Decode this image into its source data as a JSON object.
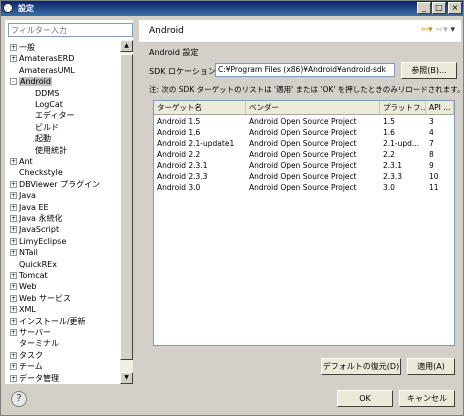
{
  "window": {
    "title": "設定",
    "min_label": "_",
    "max_label": "□",
    "close_label": "×"
  },
  "filter": {
    "placeholder": "フィルター入力"
  },
  "tree": [
    {
      "label": "一般",
      "expander": "+"
    },
    {
      "label": "AmaterasERD",
      "expander": "+"
    },
    {
      "label": "AmaterasUML",
      "expander": ""
    },
    {
      "label": "Android",
      "expander": "-",
      "selected": true
    },
    {
      "label": "DDMS",
      "child": true
    },
    {
      "label": "LogCat",
      "child": true
    },
    {
      "label": "エディター",
      "child": true
    },
    {
      "label": "ビルド",
      "child": true
    },
    {
      "label": "起動",
      "child": true
    },
    {
      "label": "使用統計",
      "child": true
    },
    {
      "label": "Ant",
      "expander": "+"
    },
    {
      "label": "Checkstyle",
      "expander": ""
    },
    {
      "label": "DBViewer プラグイン",
      "expander": "+"
    },
    {
      "label": "Java",
      "expander": "+"
    },
    {
      "label": "Java EE",
      "expander": "+"
    },
    {
      "label": "Java 永続化",
      "expander": "+"
    },
    {
      "label": "JavaScript",
      "expander": "+"
    },
    {
      "label": "LimyEclipse",
      "expander": "+"
    },
    {
      "label": "NTail",
      "expander": "+"
    },
    {
      "label": "QuickREx",
      "expander": ""
    },
    {
      "label": "Tomcat",
      "expander": "+"
    },
    {
      "label": "Web",
      "expander": "+"
    },
    {
      "label": "Web サービス",
      "expander": "+"
    },
    {
      "label": "XML",
      "expander": "+"
    },
    {
      "label": "インストール/更新",
      "expander": "+"
    },
    {
      "label": "サーバー",
      "expander": "+"
    },
    {
      "label": "ターミナル",
      "expander": ""
    },
    {
      "label": "タスク",
      "expander": "+"
    },
    {
      "label": "チーム",
      "expander": "+"
    },
    {
      "label": "データ管理",
      "expander": "+"
    }
  ],
  "page": {
    "title": "Android",
    "subtitle": "Android 設定",
    "sdk_label": "SDK ロケーション:",
    "sdk_value": "C:¥Program Files (x86)¥Android¥android-sdk",
    "browse_label": "参照(B)...",
    "note": "注: 次の SDK ターゲットのリストは '適用' または 'OK' を押したときのみリロードされます。"
  },
  "table": {
    "columns": [
      "ターゲット名",
      "ベンダー",
      "プラットフ...",
      "API ..."
    ],
    "rows": [
      [
        "Android 1.5",
        "Android Open Source Project",
        "1.5",
        "3"
      ],
      [
        "Android 1.6",
        "Android Open Source Project",
        "1.6",
        "4"
      ],
      [
        "Android 2.1-update1",
        "Android Open Source Project",
        "2.1-upd...",
        "7"
      ],
      [
        "Android 2.2",
        "Android Open Source Project",
        "2.2",
        "8"
      ],
      [
        "Android 2.3.1",
        "Android Open Source Project",
        "2.3.1",
        "9"
      ],
      [
        "Android 2.3.3",
        "Android Open Source Project",
        "2.3.3",
        "10"
      ],
      [
        "Android 3.0",
        "Android Open Source Project",
        "3.0",
        "11"
      ]
    ]
  },
  "buttons": {
    "restore_defaults": "デフォルトの復元(D)",
    "apply": "適用(A)",
    "ok": "OK",
    "cancel": "キャンセル",
    "help": "?"
  },
  "colors": {
    "titlebar": "#0a246a",
    "accent_arrow": "#c98b16"
  }
}
